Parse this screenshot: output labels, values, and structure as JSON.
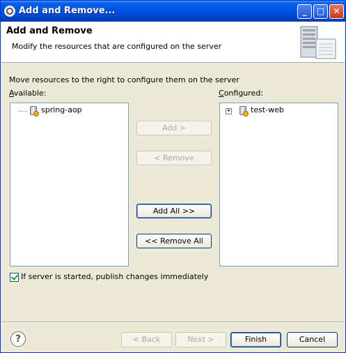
{
  "window": {
    "title": "Add and Remove...",
    "minimize_label": "_",
    "maximize_label": "□",
    "close_label": "✕"
  },
  "header": {
    "title": "Add and Remove",
    "description": "Modify the resources that are configured on the server"
  },
  "body": {
    "hint": "Move resources to the right to configure them on the server",
    "available_label": "Available:",
    "configured_label": "Configured:",
    "available_items": [
      "spring-aop"
    ],
    "configured_items": [
      "test-web"
    ]
  },
  "buttons": {
    "add": "Add >",
    "remove": "< Remove",
    "add_all": "Add All >>",
    "remove_all": "<< Remove All"
  },
  "publish_checkbox": {
    "label": "If server is started, publish changes immediately",
    "checked": true
  },
  "footer": {
    "help_label": "?",
    "back": "< Back",
    "next": "Next >",
    "finish": "Finish",
    "cancel": "Cancel"
  }
}
